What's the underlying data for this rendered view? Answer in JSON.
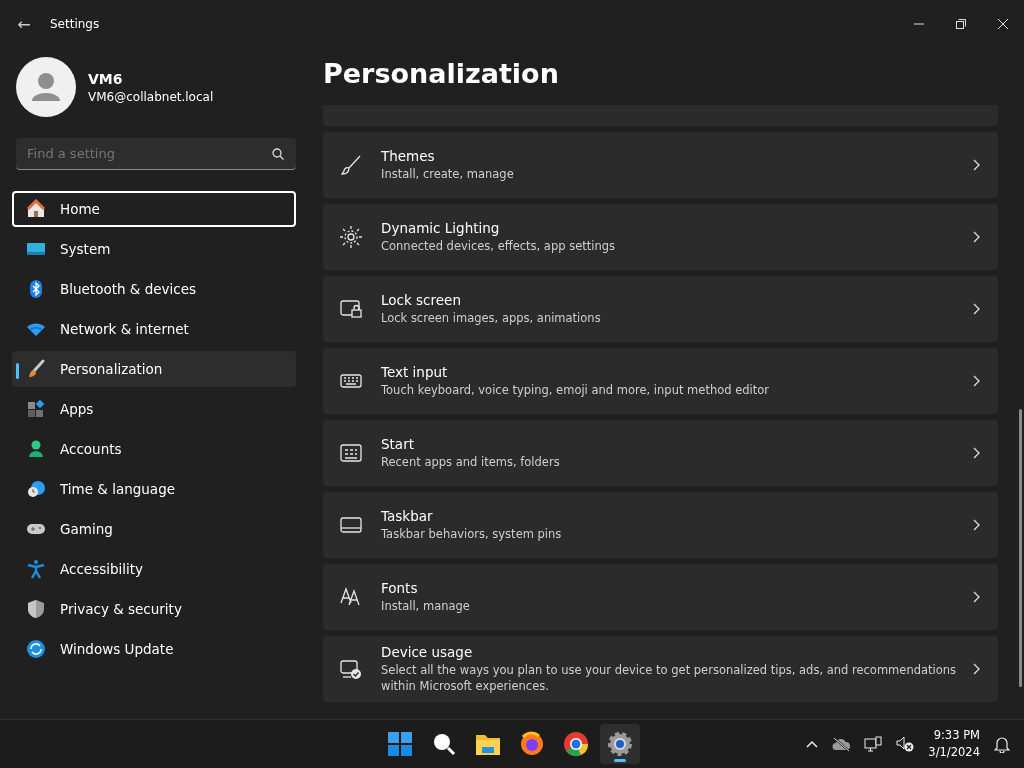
{
  "window": {
    "title": "Settings",
    "back": "←"
  },
  "user": {
    "name": "VM6",
    "email": "VM6@collabnet.local"
  },
  "search": {
    "placeholder": "Find a setting"
  },
  "sidebar": {
    "items": [
      {
        "label": "Home",
        "selected": false,
        "focused": true
      },
      {
        "label": "System",
        "selected": false,
        "focused": false
      },
      {
        "label": "Bluetooth & devices",
        "selected": false,
        "focused": false
      },
      {
        "label": "Network & internet",
        "selected": false,
        "focused": false
      },
      {
        "label": "Personalization",
        "selected": true,
        "focused": false
      },
      {
        "label": "Apps",
        "selected": false,
        "focused": false
      },
      {
        "label": "Accounts",
        "selected": false,
        "focused": false
      },
      {
        "label": "Time & language",
        "selected": false,
        "focused": false
      },
      {
        "label": "Gaming",
        "selected": false,
        "focused": false
      },
      {
        "label": "Accessibility",
        "selected": false,
        "focused": false
      },
      {
        "label": "Privacy & security",
        "selected": false,
        "focused": false
      },
      {
        "label": "Windows Update",
        "selected": false,
        "focused": false
      }
    ]
  },
  "page": {
    "title": "Personalization",
    "cards": [
      {
        "title": "Themes",
        "subtitle": "Install, create, manage"
      },
      {
        "title": "Dynamic Lighting",
        "subtitle": "Connected devices, effects, app settings"
      },
      {
        "title": "Lock screen",
        "subtitle": "Lock screen images, apps, animations"
      },
      {
        "title": "Text input",
        "subtitle": "Touch keyboard, voice typing, emoji and more, input method editor"
      },
      {
        "title": "Start",
        "subtitle": "Recent apps and items, folders"
      },
      {
        "title": "Taskbar",
        "subtitle": "Taskbar behaviors, system pins"
      },
      {
        "title": "Fonts",
        "subtitle": "Install, manage"
      },
      {
        "title": "Device usage",
        "subtitle": "Select all the ways you plan to use your device to get personalized tips, ads, and recommendations within Microsoft experiences."
      }
    ]
  },
  "taskbar": {
    "apps": [
      {
        "active": false
      },
      {
        "active": false
      },
      {
        "active": false
      },
      {
        "active": false
      },
      {
        "active": false
      },
      {
        "active": true
      }
    ],
    "time": "9:33 PM",
    "date": "3/1/2024"
  }
}
